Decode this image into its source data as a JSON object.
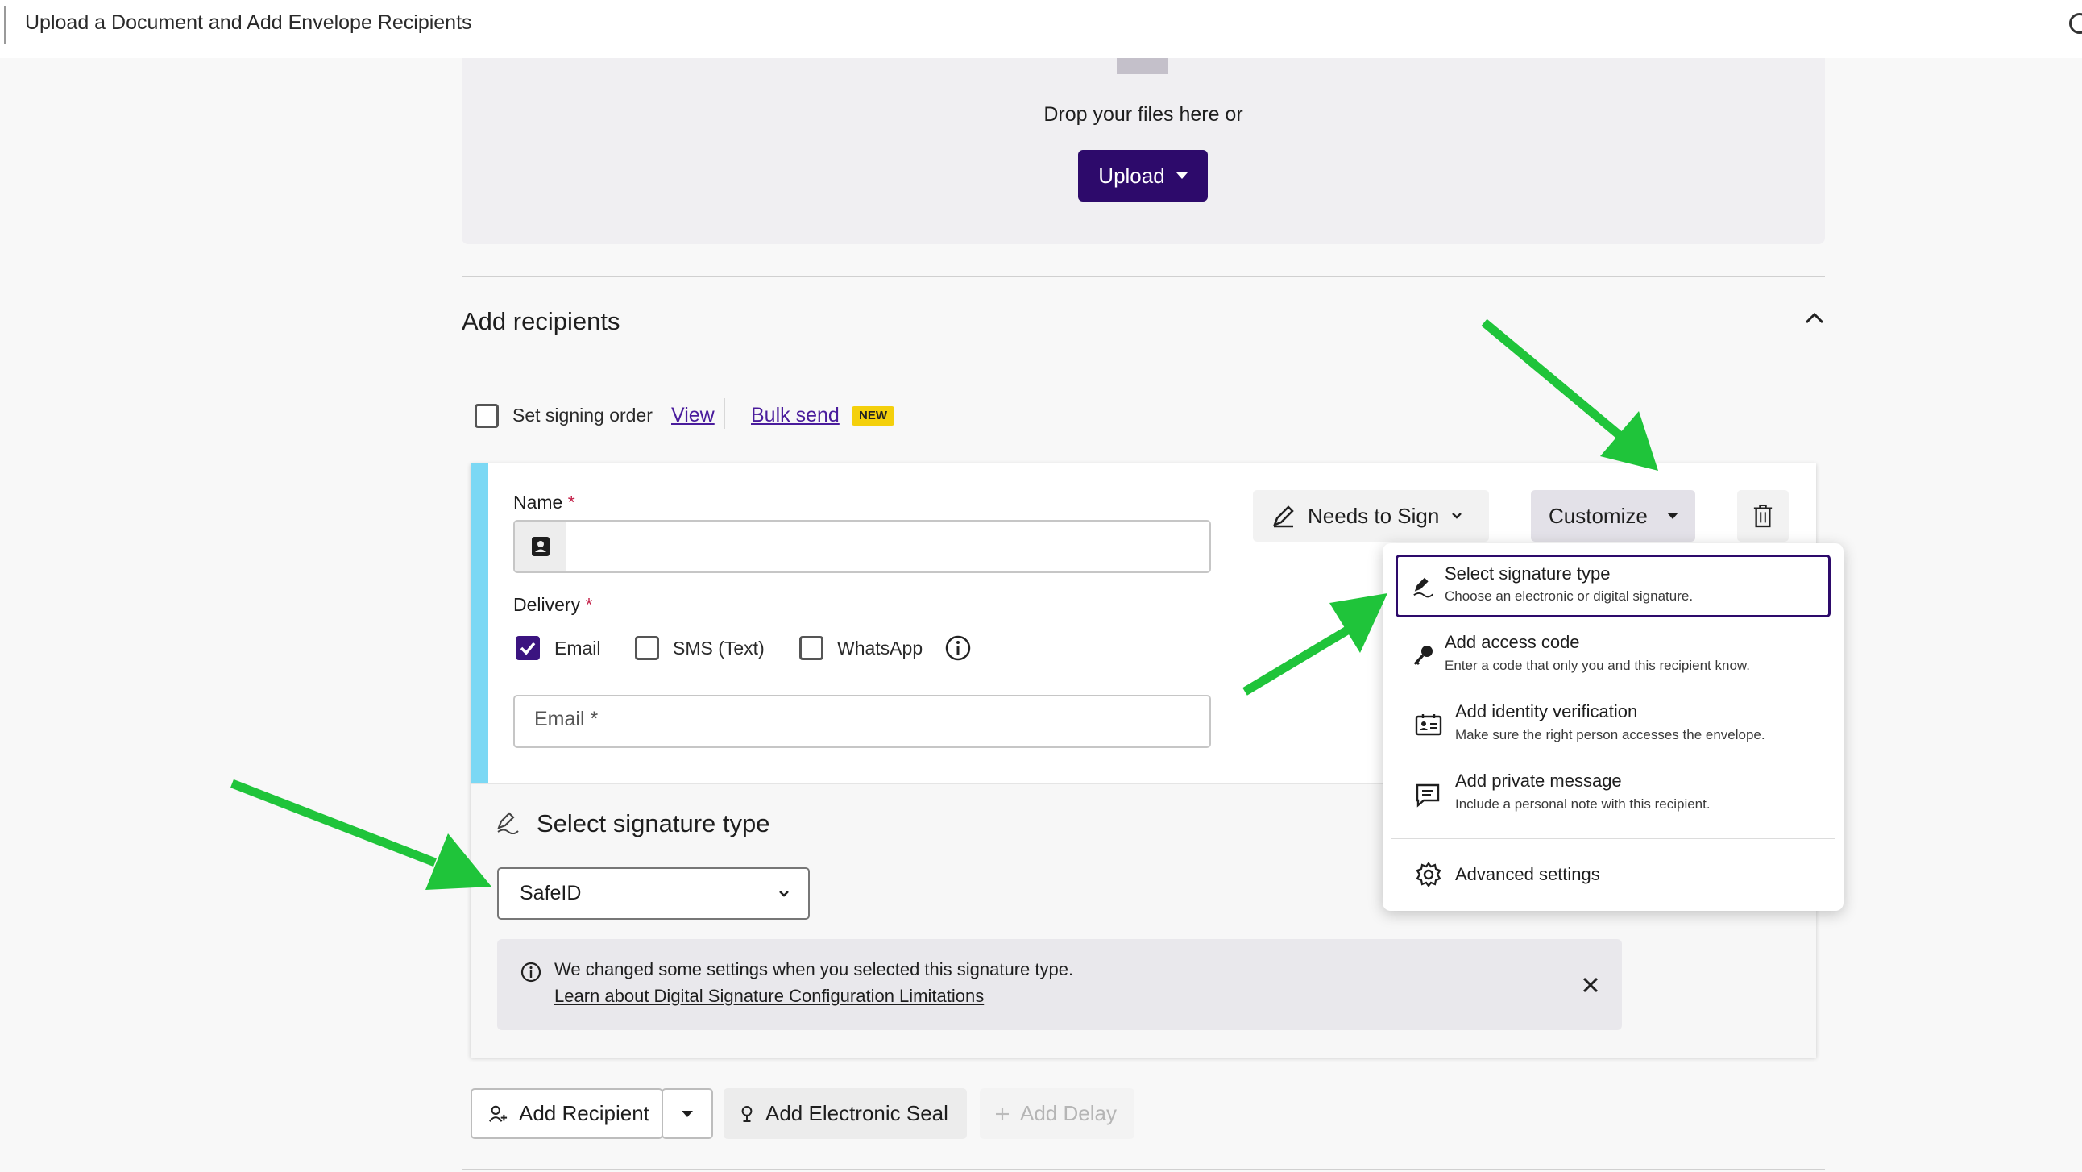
{
  "page": {
    "title": "Upload a Document and Add Envelope Recipients"
  },
  "upload": {
    "drop_text": "Drop your files here or",
    "button_label": "Upload"
  },
  "recipients": {
    "section_title": "Add recipients",
    "signing_order_label": "Set signing order",
    "view_link": "View",
    "bulk_send_link": "Bulk send",
    "new_badge": "NEW"
  },
  "card": {
    "name_label": "Name",
    "required_mark": "*",
    "name_value": "",
    "delivery_label": "Delivery",
    "delivery_options": [
      {
        "label": "Email",
        "checked": true
      },
      {
        "label": "SMS (Text)",
        "checked": false
      },
      {
        "label": "WhatsApp",
        "checked": false
      }
    ],
    "email_placeholder": "Email *",
    "role_label": "Needs to Sign",
    "customize_label": "Customize",
    "signature_section_title": "Select signature type",
    "signature_type_value": "SafeID",
    "notice_text": "We changed some settings when you selected this signature type.",
    "notice_link": "Learn about Digital Signature Configuration Limitations"
  },
  "customize_menu": {
    "items": [
      {
        "title": "Select signature type",
        "subtitle": "Choose an electronic or digital signature.",
        "icon": "signature-pen-icon",
        "selected": true
      },
      {
        "title": "Add access code",
        "subtitle": "Enter a code that only you and this recipient know.",
        "icon": "key-icon"
      },
      {
        "title": "Add identity verification",
        "subtitle": "Make sure the right person accesses the envelope.",
        "icon": "id-card-icon"
      },
      {
        "title": "Add private message",
        "subtitle": "Include a personal note with this recipient.",
        "icon": "message-icon"
      }
    ],
    "advanced_label": "Advanced settings"
  },
  "actions": {
    "add_recipient": "Add Recipient",
    "add_seal": "Add Electronic Seal",
    "add_delay": "Add Delay"
  },
  "colors": {
    "accent": "#2d0a6b",
    "stripe": "#7bd8f4",
    "badge": "#f4d00c",
    "arrow": "#1fc43a",
    "required": "#c4224a"
  }
}
